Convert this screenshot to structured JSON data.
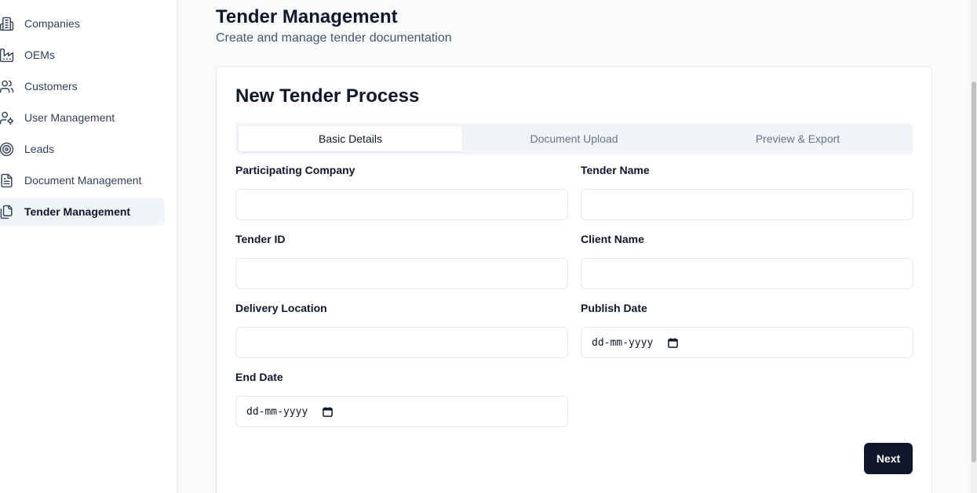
{
  "sidebar": {
    "items": [
      {
        "label": "Companies",
        "icon": "building-icon",
        "active": false
      },
      {
        "label": "OEMs",
        "icon": "factory-icon",
        "active": false
      },
      {
        "label": "Customers",
        "icon": "users-icon",
        "active": false
      },
      {
        "label": "User Management",
        "icon": "user-cog-icon",
        "active": false
      },
      {
        "label": "Leads",
        "icon": "target-icon",
        "active": false
      },
      {
        "label": "Document Management",
        "icon": "file-text-icon",
        "active": false
      },
      {
        "label": "Tender Management",
        "icon": "files-icon",
        "active": true
      }
    ]
  },
  "header": {
    "title": "Tender Management",
    "subtitle": "Create and manage tender documentation"
  },
  "card": {
    "title": "New Tender Process",
    "tabs": [
      {
        "label": "Basic Details",
        "active": true
      },
      {
        "label": "Document Upload",
        "active": false
      },
      {
        "label": "Preview & Export",
        "active": false
      }
    ],
    "fields": {
      "participating_company": {
        "label": "Participating Company",
        "value": ""
      },
      "tender_name": {
        "label": "Tender Name",
        "value": ""
      },
      "tender_id": {
        "label": "Tender ID",
        "value": ""
      },
      "client_name": {
        "label": "Client Name",
        "value": ""
      },
      "delivery_location": {
        "label": "Delivery Location",
        "value": ""
      },
      "publish_date": {
        "label": "Publish Date",
        "placeholder": "dd-mm-yyyy"
      },
      "end_date": {
        "label": "End Date",
        "placeholder": "dd-mm-yyyy"
      }
    },
    "next_label": "Next"
  },
  "colors": {
    "primary": "#0f172a",
    "muted_text": "#64748b",
    "border": "#e2e8f0",
    "active_bg": "#f1f5f9"
  }
}
